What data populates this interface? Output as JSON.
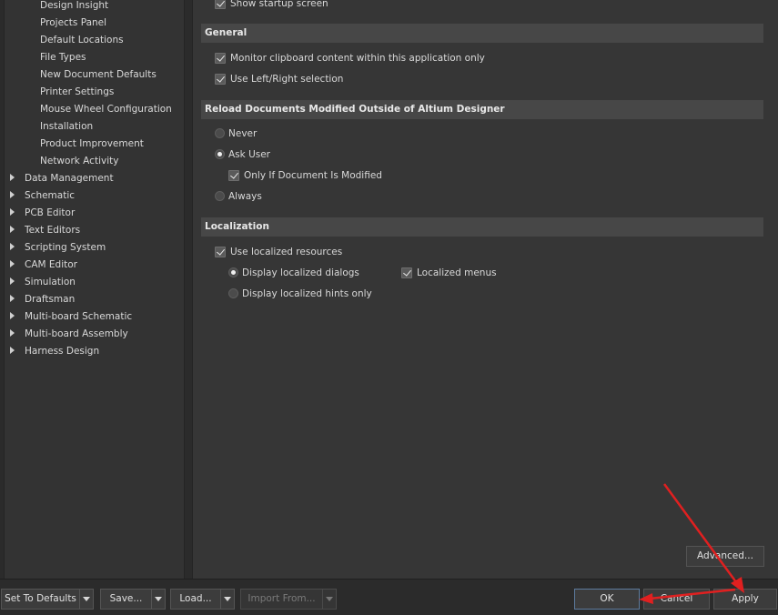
{
  "tree": {
    "children": [
      {
        "label": "Design Insight"
      },
      {
        "label": "Projects Panel"
      },
      {
        "label": "Default Locations"
      },
      {
        "label": "File Types"
      },
      {
        "label": "New Document Defaults"
      },
      {
        "label": "Printer Settings"
      },
      {
        "label": "Mouse Wheel Configuration"
      },
      {
        "label": "Installation"
      },
      {
        "label": "Product Improvement"
      },
      {
        "label": "Network Activity"
      }
    ],
    "roots": [
      {
        "label": "Data Management"
      },
      {
        "label": "Schematic"
      },
      {
        "label": "PCB Editor"
      },
      {
        "label": "Text Editors"
      },
      {
        "label": "Scripting System"
      },
      {
        "label": "CAM Editor"
      },
      {
        "label": "Simulation"
      },
      {
        "label": "Draftsman"
      },
      {
        "label": "Multi-board Schematic"
      },
      {
        "label": "Multi-board Assembly"
      },
      {
        "label": "Harness Design"
      }
    ]
  },
  "startup": {
    "show_startup_screen": "Show startup screen"
  },
  "general": {
    "title": "General",
    "monitor_clipboard": "Monitor clipboard content within this application only",
    "left_right_selection": "Use Left/Right selection"
  },
  "reload": {
    "title": "Reload Documents Modified Outside of Altium Designer",
    "never": "Never",
    "ask_user": "Ask User",
    "only_if_modified": "Only If Document Is Modified",
    "always": "Always",
    "selected": "Ask User"
  },
  "localization": {
    "title": "Localization",
    "use_localized": "Use localized resources",
    "display_dialogs": "Display localized dialogs",
    "localized_menus": "Localized menus",
    "display_hints": "Display localized hints only"
  },
  "buttons": {
    "advanced": "Advanced...",
    "set_to_defaults": "Set To Defaults",
    "save": "Save...",
    "load": "Load...",
    "import_from": "Import From...",
    "ok": "OK",
    "cancel": "Cancel",
    "apply": "Apply"
  },
  "colors": {
    "annotation": "#e02020",
    "background": "#2b2b2b",
    "panel": "#363636",
    "section_header": "#474747"
  }
}
